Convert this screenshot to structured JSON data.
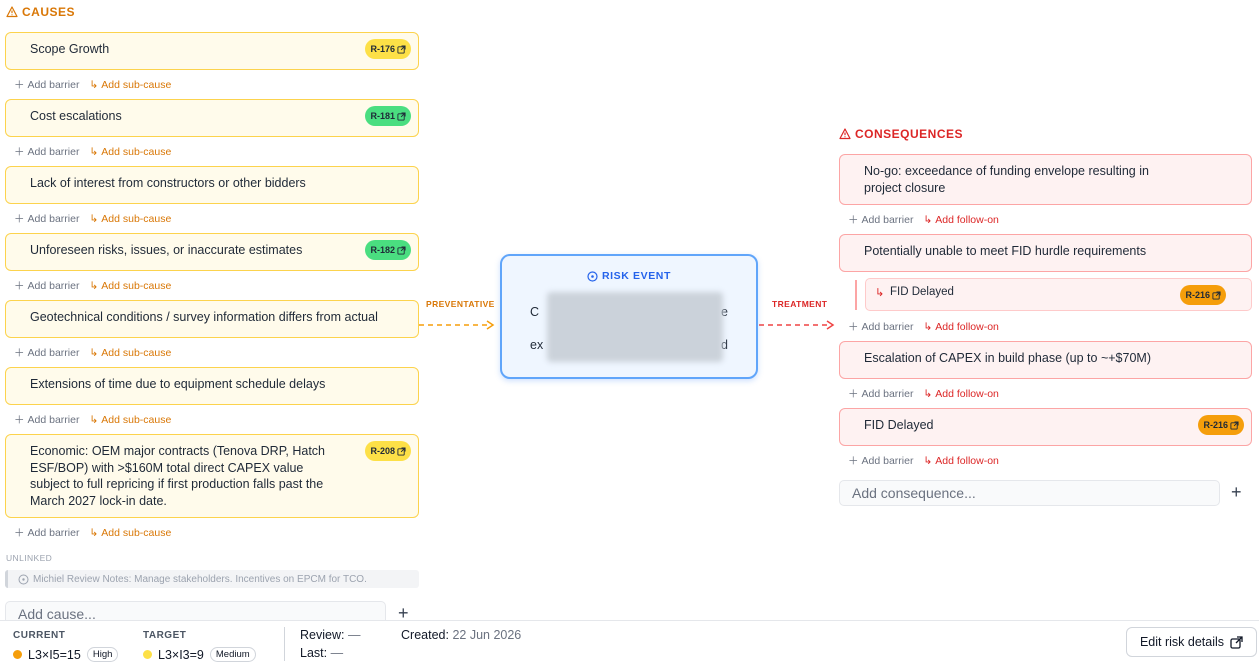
{
  "causes": {
    "title": "CAUSES",
    "items": [
      {
        "text": "Scope Growth",
        "badge": "R-176",
        "badge_color": "#fde047"
      },
      {
        "text": "Cost escalations",
        "badge": "R-181",
        "badge_color": "#4ade80"
      },
      {
        "text": "Lack of interest from constructors or other bidders",
        "badge": ""
      },
      {
        "text": "Unforeseen risks, issues, or inaccurate estimates",
        "badge": "R-182",
        "badge_color": "#4ade80"
      },
      {
        "text": "Geotechnical conditions / survey information differs from actual",
        "badge": ""
      },
      {
        "text": "Extensions of time due to equipment schedule delays",
        "badge": ""
      },
      {
        "text": "Economic: OEM major contracts (Tenova DRP, Hatch ESF/BOP) with >$160M total direct CAPEX value subject to full repricing if first production falls past the March 2027 lock-in date.",
        "badge": "R-208",
        "badge_color": "#fde047"
      }
    ],
    "add_barrier": "Add barrier",
    "add_sub_cause": "Add sub-cause",
    "unlinked_label": "UNLINKED",
    "unlinked_note": "Michiel Review Notes: Manage stakeholders. Incentives on EPCM for TCO.",
    "add_placeholder": "Add cause..."
  },
  "risk_event": {
    "title": "RISK EVENT",
    "line1_start": "C",
    "line1_end": "e",
    "line2_start": "ex",
    "line2_end": "d"
  },
  "flow": {
    "preventative": "PREVENTATIVE",
    "treatment": "TREATMENT"
  },
  "consequences": {
    "title": "CONSEQUENCES",
    "items": [
      {
        "text": "No-go: exceedance of funding envelope resulting in project closure",
        "badge": ""
      },
      {
        "text": "Potentially unable to meet FID hurdle requirements",
        "badge": ""
      },
      {
        "text": "Escalation of CAPEX in build phase (up to ~+$70M)",
        "badge": ""
      },
      {
        "text": "FID Delayed",
        "badge": "R-216",
        "badge_color": "#f59e0b"
      }
    ],
    "follow_on": {
      "text": "FID Delayed",
      "badge": "R-216"
    },
    "add_barrier": "Add barrier",
    "add_follow_on": "Add follow-on",
    "add_placeholder": "Add consequence..."
  },
  "footer": {
    "current_label": "CURRENT",
    "current_value": "L3×I5=15",
    "current_level": "High",
    "current_color": "#f59e0b",
    "target_label": "TARGET",
    "target_value": "L3×I3=9",
    "target_level": "Medium",
    "target_color": "#fde047",
    "review_label": "Review:",
    "review_value": "—",
    "last_label": "Last:",
    "last_value": "—",
    "created_label": "Created:",
    "created_value": "22 Jun 2026",
    "edit_button": "Edit risk details"
  }
}
